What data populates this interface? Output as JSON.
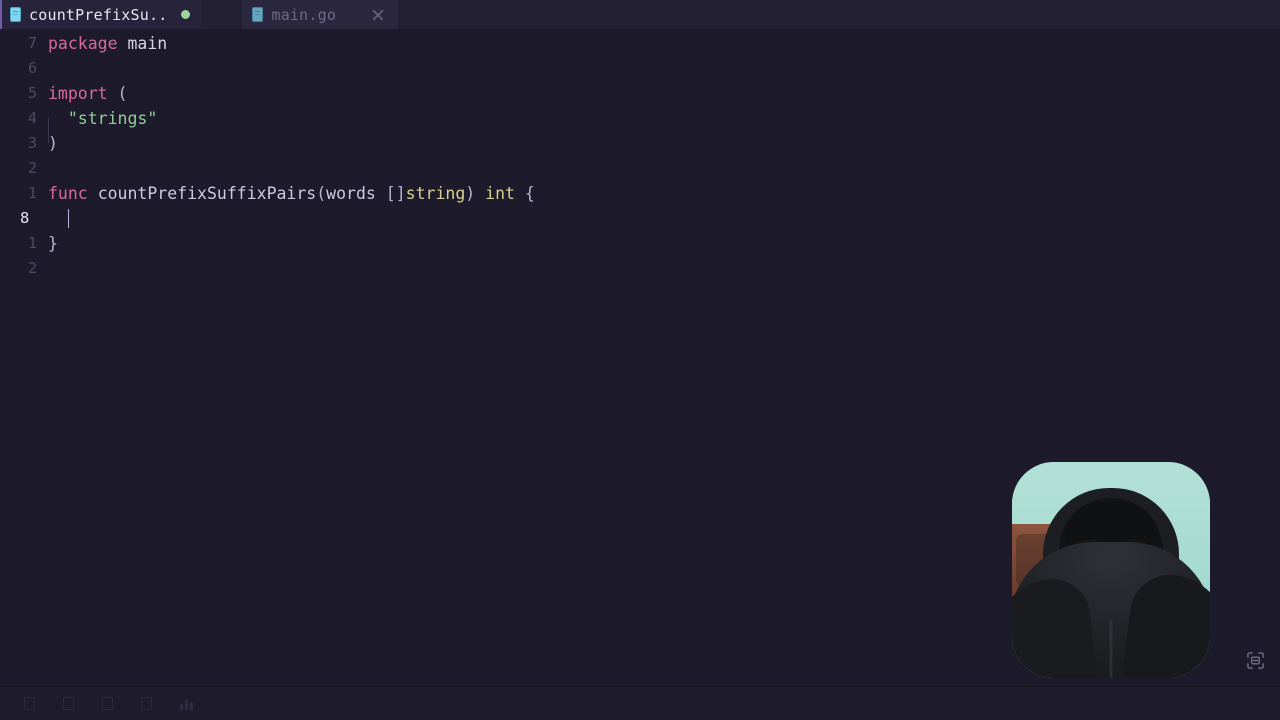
{
  "app": {
    "theme_bg": "#1d1a2b",
    "tabbar_bg": "#232033"
  },
  "tabbar": {
    "tabs": [
      {
        "label": "countPrefixSu..",
        "icon": "go-file-icon",
        "state": "active",
        "modified": true,
        "modified_indicator_color": "#9ed49b"
      },
      {
        "label": "main.go",
        "icon": "go-file-icon",
        "state": "inactive",
        "modified": false,
        "close_label": "×"
      }
    ]
  },
  "editor": {
    "language": "go",
    "filename": "countPrefixSuffixPairs.go",
    "cursor_line": 8,
    "cursor_column": 2,
    "line_number_mode": "relative",
    "lines": [
      {
        "gutter": "7",
        "current": false,
        "tokens": [
          {
            "t": "package",
            "c": "kw"
          },
          {
            "t": " ",
            "c": "pln"
          },
          {
            "t": "main",
            "c": "pln"
          }
        ]
      },
      {
        "gutter": "6",
        "current": false,
        "tokens": []
      },
      {
        "gutter": "5",
        "current": false,
        "tokens": [
          {
            "t": "import",
            "c": "kw"
          },
          {
            "t": " ",
            "c": "pln"
          },
          {
            "t": "(",
            "c": "pun"
          }
        ]
      },
      {
        "gutter": "4",
        "current": false,
        "indent_guide": true,
        "tokens": [
          {
            "t": "  ",
            "c": "pln"
          },
          {
            "t": "\"strings\"",
            "c": "str"
          }
        ]
      },
      {
        "gutter": "3",
        "current": false,
        "tokens": [
          {
            "t": ")",
            "c": "pun"
          }
        ]
      },
      {
        "gutter": "2",
        "current": false,
        "tokens": []
      },
      {
        "gutter": "1",
        "current": false,
        "tokens": [
          {
            "t": "func",
            "c": "kw"
          },
          {
            "t": " ",
            "c": "pln"
          },
          {
            "t": "countPrefixSuffixPairs",
            "c": "fn"
          },
          {
            "t": "(",
            "c": "pun"
          },
          {
            "t": "words",
            "c": "var"
          },
          {
            "t": " ",
            "c": "pln"
          },
          {
            "t": "[]",
            "c": "pun"
          },
          {
            "t": "string",
            "c": "typ"
          },
          {
            "t": ")",
            "c": "pun"
          },
          {
            "t": " ",
            "c": "pln"
          },
          {
            "t": "int",
            "c": "typ"
          },
          {
            "t": " ",
            "c": "pln"
          },
          {
            "t": "{",
            "c": "pun"
          }
        ]
      },
      {
        "gutter": "8",
        "current": true,
        "caret": true,
        "tokens": [
          {
            "t": "  ",
            "c": "pln"
          }
        ]
      },
      {
        "gutter": "1",
        "current": false,
        "tokens": [
          {
            "t": "}",
            "c": "pun"
          }
        ]
      },
      {
        "gutter": "2",
        "current": false,
        "tokens": []
      }
    ]
  },
  "webcam": {
    "label": "webcam-overlay",
    "background_color": "#a9dcd3"
  },
  "overlay_controls": {
    "fullscreen_icon": "expand-screen-icon"
  },
  "statusbar": {
    "items": [
      {
        "name": "status-item-1",
        "glyph": "document-icon",
        "label": ""
      },
      {
        "name": "status-item-2",
        "glyph": "branch-icon",
        "label": ""
      },
      {
        "name": "status-item-3",
        "glyph": "check-icon",
        "label": ""
      },
      {
        "name": "status-item-4",
        "glyph": "text-icon",
        "label": ""
      },
      {
        "name": "status-item-5",
        "glyph": "bars-icon",
        "label": ""
      }
    ]
  }
}
